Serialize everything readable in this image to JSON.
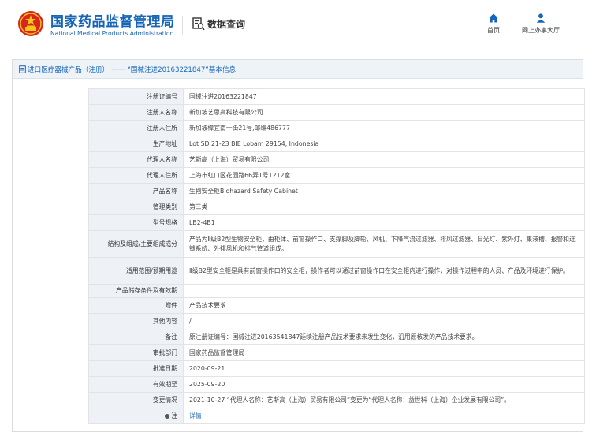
{
  "header": {
    "site_title_cn": "国家药品监督管理局",
    "site_title_en": "National Medical Products Administration",
    "section_label": "数据查询",
    "nav": [
      {
        "label": "首页",
        "icon": "home-icon"
      },
      {
        "label": "网上办事大厅",
        "icon": "user-icon"
      }
    ]
  },
  "breadcrumb": {
    "category": "进口医疗器械产品（注册）",
    "separator": "——",
    "record": "“国械注进20163221847”基本信息"
  },
  "details": [
    {
      "key": "注册证编号",
      "value": "国械注进20163221847"
    },
    {
      "key": "注册人名称",
      "value": "新加坡艺思高科技有限公司"
    },
    {
      "key": "注册人住所",
      "value": "新加坡樟宜南一街21号,邮编486777"
    },
    {
      "key": "生产地址",
      "value": "Lot SD 21-23 BIE Lobam 29154, Indonesia"
    },
    {
      "key": "代理人名称",
      "value": "艺斯高（上海）贸易有限公司"
    },
    {
      "key": "代理人住所",
      "value": "上海市虹口区花园路66弄1号1212室"
    },
    {
      "key": "产品名称",
      "value": "生物安全柜Biohazard Safety Cabinet"
    },
    {
      "key": "管理类别",
      "value": "第三类"
    },
    {
      "key": "型号规格",
      "value": "LB2-4B1"
    },
    {
      "key": "结构及组成/主要组成成分",
      "value": "产品为Ⅱ级B2型生物安全柜，由柜体、前窗操作口、支撑脚及脚轮、风机、下降气流过滤器、排风过滤器、日光灯、紫外灯、集液槽、报警和连锁系统、外排风机和排气管道组成。"
    },
    {
      "key": "适用范围/预期用途",
      "value": "Ⅱ级B2型安全柜是具有前窗操作口的安全柜，操作者可以通过前窗操作口在安全柜内进行操作，对操作过程中的人员、产品及环境进行保护。"
    },
    {
      "key": "产品储存条件及有效期",
      "value": ""
    },
    {
      "key": "附件",
      "value": "产品技术要求"
    },
    {
      "key": "其他内容",
      "value": "/"
    },
    {
      "key": "备注",
      "value": "原注册证编号：国械注进20163541847延续注册产品技术要求未发生变化，沿用原核发的产品技术要求。"
    },
    {
      "key": "审批部门",
      "value": "国家药品监督管理局"
    },
    {
      "key": "批准日期",
      "value": "2020-09-21"
    },
    {
      "key": "有效期至",
      "value": "2025-09-20"
    },
    {
      "key": "变更情况",
      "value": "2021-10-27 “代理人名称：艺斯高（上海）贸易有限公司”变更为“代理人名称：益世科（上海）企业发展有限公司”。"
    },
    {
      "key": "注",
      "value": "详情",
      "is_link": true
    }
  ],
  "colors": {
    "brand_blue": "#1565b8",
    "key_cell_bg": "#eef2f7",
    "title_bar_bg": "#eef3f8",
    "emblem_red": "#d7261e",
    "emblem_gold": "#f5c518"
  }
}
